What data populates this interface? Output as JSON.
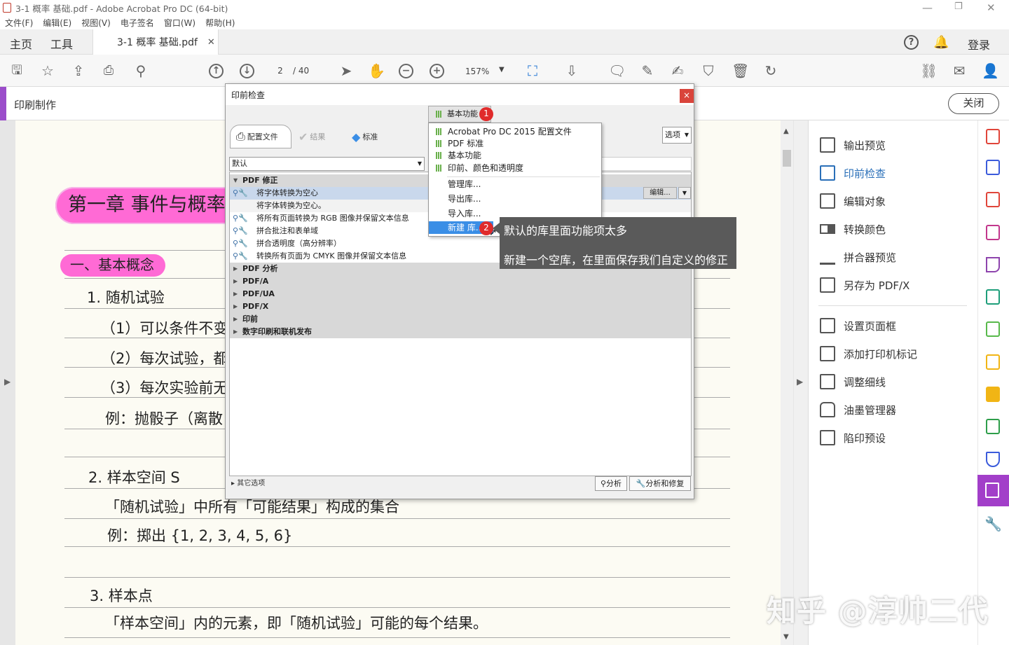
{
  "window": {
    "title": "3-1 概率 基础.pdf - Adobe Acrobat Pro DC (64-bit)"
  },
  "menu": [
    "文件(F)",
    "编辑(E)",
    "视图(V)",
    "电子签名",
    "窗口(W)",
    "帮助(H)"
  ],
  "tabs": {
    "home": "主页",
    "tools": "工具",
    "doc": "3-1 概率 基础.pdf",
    "login": "登录"
  },
  "toolbar": {
    "page_current": "2",
    "page_total": "/ 40",
    "zoom": "157%"
  },
  "tools_bar": {
    "title": "印刷制作",
    "close": "关闭"
  },
  "page_content": {
    "chapter": "第一章 事件与概率",
    "section": "一、基本概念",
    "item1": "1. 随机试验",
    "c1": "（1）可以条件不变",
    "c2": "（2）每次试验，都",
    "c3": "（3）每次实验前无",
    "ex1": "例：抛骰子（离散",
    "item2": "2. 样本空间 S",
    "s_def": "「随机试验」中所有「可能结果」构成的集合",
    "ex2": "例：掷出 {1, 2, 3, 4, 5, 6}",
    "item3": "3. 样本点",
    "p_def": "「样本空间」内的元素，即「随机试验」可能的每个结果。"
  },
  "right_panel": {
    "group1": [
      "输出预览",
      "印前检查",
      "编辑对象",
      "转换颜色",
      "拼合器预览",
      "另存为 PDF/X"
    ],
    "group2": [
      "设置页面框",
      "添加打印机标记",
      "调整细线",
      "油墨管理器",
      "陷印预设"
    ]
  },
  "dialog": {
    "title": "印前检查",
    "close": "×",
    "tabs": [
      "配置文件",
      "结果",
      "标准"
    ],
    "profile_select": "默认",
    "options_btn": "选项",
    "edit_btn": "编辑...",
    "library_btn": "基本功能",
    "groups": {
      "pdf_fix": "PDF 修正",
      "pdf_analysis": "PDF 分析",
      "pdfa": "PDF/A",
      "pdfua": "PDF/UA",
      "pdfx": "PDF/X",
      "prepress": "印前",
      "digital": "数字印刷和联机发布"
    },
    "fixes": {
      "f1": "将字体转换为空心",
      "f1_desc": "将字体转换为空心。",
      "f2": "将所有页面转换为 RGB 图像并保留文本信息",
      "f3": "拼合批注和表单域",
      "f4": "拼合透明度（高分辨率）",
      "f5": "转换所有页面为 CMYK 图像并保留文本信息"
    },
    "footer": {
      "more": "其它选项",
      "analyze": "分析",
      "analyze_fix": "分析和修复"
    }
  },
  "library_menu": {
    "items": [
      "Acrobat Pro DC 2015 配置文件",
      "PDF 标准",
      "基本功能",
      "印前、颜色和透明度"
    ],
    "actions": [
      "管理库...",
      "导出库...",
      "导入库...",
      "新建 库..."
    ]
  },
  "badges": {
    "b1": "1",
    "b2": "2"
  },
  "tooltip": {
    "line1": "默认的库里面功能项太多",
    "line2": "新建一个空库，在里面保存我们自定义的修正"
  },
  "watermark": "知乎 @淳帅二代",
  "colors": {
    "accent": "#9b4dca",
    "highlight": "#ff6ad5",
    "selected": "#3a8ee6",
    "badge": "#e02b2b"
  }
}
